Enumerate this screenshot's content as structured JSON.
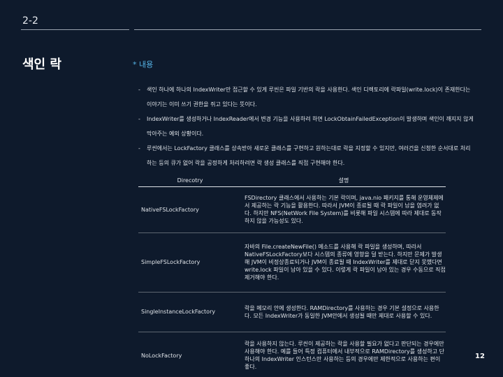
{
  "slide": {
    "number_top": "2-2",
    "title": "색인 락",
    "section": "* 내용",
    "page_number": "12"
  },
  "bullets": [
    "색인 하나에 하나의 IndexWriter만 접근할 수 있게 루씬은 파일 기반의 락을 사용한다. 색인 디렉토리에 락파일(write.lock)이 존재한다는 이야기는 이미 쓰기 권한을 쥐고 있다는 뜻이다.",
    "IndexWriter를 생성하거나 IndexReader에서 변경 기능을 사용하려 하면 LockObtainFailedException이 발생하며 색인이 깨지지 않게 막아주는 예외 상황이다.",
    "루씬에서는 LockFactory 클래스를 상속받아 새로운 클래스를 구현하고 원하는대로 락을 지정할 수 있지만, 여러건을 신청한 순서대로 처리하는 등의 큐가 없어 락을 공정하게 처리하려면 락 생성 클래스를 직접 구현해야 한다."
  ],
  "table": {
    "headers": [
      "Direcotry",
      "설명"
    ],
    "rows": [
      {
        "name": "NativeFSLockFactory",
        "desc": "FSDirectory 클래스에서 사용하는 기본 락이며, java.nio 패키지를 통해 운영체제에서 제공하는 락 기능을 활용한다. 따라서 JVM이 종료될 때 락 파일이 남을 염려가 없다. 하지만 NFS(NetWork File System)를 비롯해 파일 시스템에 따라 제대로 동작하지 않을 가능성도 있다."
      },
      {
        "name": "SimpleFSLockFactory",
        "desc": "자바의 File.createNewFile() 메소드를 사용해 락 파일을 생성하며, 따라서 NativeFSLockFactory보다 시스템의 종류에 영향을 덜 받는다. 하지만 문제가 발생해 JVM이 비정상종료되거나 JVM이 종료될 때 IndexWriter를 제대로 닫지 못했다면 write.lock 파일이 남아 있을 수 있다. 이렇게 락 파일이 남아 있는 경우 수동으로 직접 제거해야 한다."
      },
      {
        "name": "SingleInstanceLockFactory",
        "desc": "락을 메모리 안에 생성한다. RAMDirectory를 사용하는 경우 기본 설정으로 사용한다. 모든 IndexWriter가 동일한 JVM안에서 생성될 때만 제대로 사용할 수 있다."
      },
      {
        "name": "NoLockFactory",
        "desc": "락을 사용하지 않는다. 루씬이 제공하는 락을 사용할 필요가 없다고 판단되는 경우에만 사용해야 한다. 예를 들어 특정 컴퓨터에서 내부적으로 RAMDirectory를 생성하고 단 하나의 IndexWriter 인스턴스만 사용하는 등의 경우에만 제한적으로 사용하는 편이 좋다."
      }
    ]
  }
}
